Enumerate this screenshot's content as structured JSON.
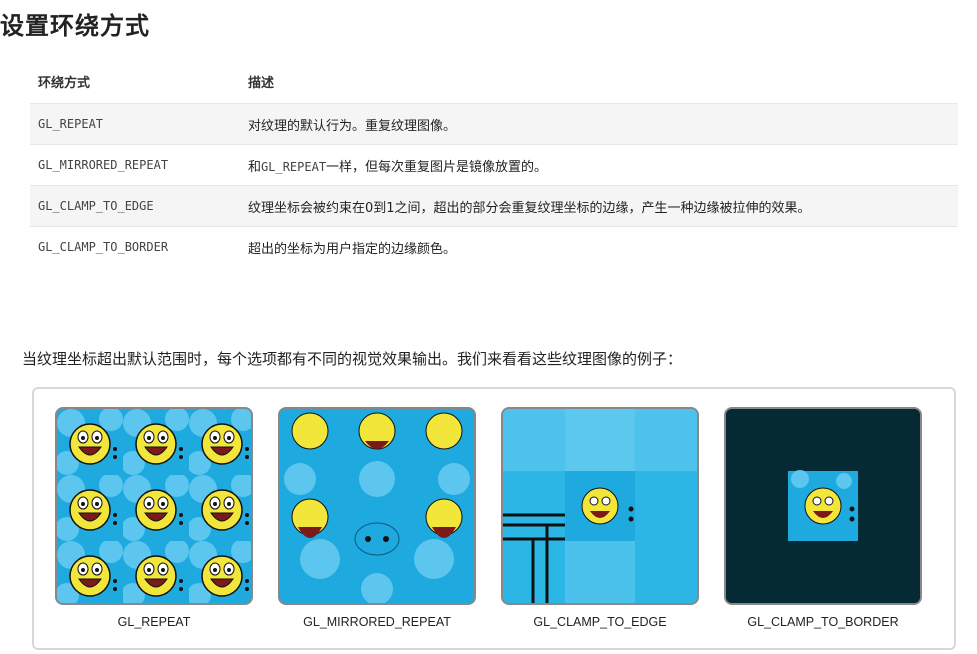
{
  "heading": "设置环绕方式",
  "table": {
    "headers": [
      "环绕方式",
      "描述"
    ],
    "rows": [
      {
        "mode": "GL_REPEAT",
        "desc": "对纹理的默认行为。重复纹理图像。"
      },
      {
        "mode": "GL_MIRRORED_REPEAT",
        "desc_pre": "和",
        "desc_code": "GL_REPEAT",
        "desc_post": "一样，但每次重复图片是镜像放置的。"
      },
      {
        "mode": "GL_CLAMP_TO_EDGE",
        "desc": "纹理坐标会被约束在0到1之间，超出的部分会重复纹理坐标的边缘，产生一种边缘被拉伸的效果。"
      },
      {
        "mode": "GL_CLAMP_TO_BORDER",
        "desc": "超出的坐标为用户指定的边缘颜色。"
      }
    ]
  },
  "intro": "当纹理坐标超出默认范围时，每个选项都有不同的视觉效果输出。我们来看看这些纹理图像的例子：",
  "gallery": {
    "captions": [
      "GL_REPEAT",
      "GL_MIRRORED_REPEAT",
      "GL_CLAMP_TO_EDGE",
      "GL_CLAMP_TO_BORDER"
    ],
    "image_names": [
      "repeat-texture-image",
      "mirrored-repeat-texture-image",
      "clamp-to-edge-texture-image",
      "clamp-to-border-texture-image"
    ]
  },
  "colors": {
    "texture_blue": "#1ea9df",
    "border_color": "#062a33",
    "face_yellow": "#f2e63a"
  }
}
